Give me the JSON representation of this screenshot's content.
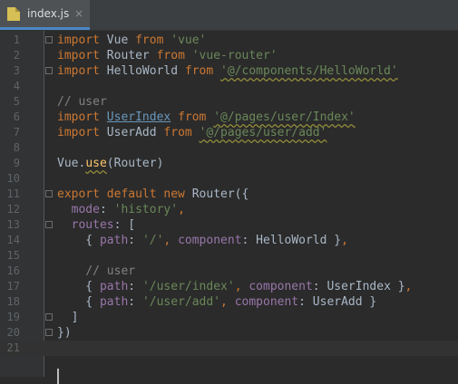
{
  "tab": {
    "filename": "index.js",
    "close_symbol": "×"
  },
  "colors": {
    "keyword": "#cc7832",
    "string": "#6a8759",
    "comment": "#808080",
    "property": "#9876aa",
    "default": "#a9b7c6",
    "background": "#2b2b2b"
  },
  "lines": [
    {
      "n": "1",
      "tokens": [
        [
          "kw",
          "import"
        ],
        [
          "p",
          " Vue "
        ],
        [
          "kw",
          "from"
        ],
        [
          "p",
          " "
        ],
        [
          "str",
          "'vue'"
        ]
      ]
    },
    {
      "n": "2",
      "tokens": [
        [
          "kw",
          "import"
        ],
        [
          "p",
          " Router "
        ],
        [
          "kw",
          "from"
        ],
        [
          "p",
          " "
        ],
        [
          "str",
          "'vue-router'"
        ]
      ]
    },
    {
      "n": "3",
      "tokens": [
        [
          "kw",
          "import"
        ],
        [
          "p",
          " HelloWorld "
        ],
        [
          "kw",
          "from"
        ],
        [
          "p",
          " "
        ],
        [
          "stru",
          "'@/components/HelloWorld'"
        ]
      ]
    },
    {
      "n": "4",
      "tokens": []
    },
    {
      "n": "5",
      "tokens": [
        [
          "cmt",
          "// user"
        ]
      ]
    },
    {
      "n": "6",
      "tokens": [
        [
          "kw",
          "import"
        ],
        [
          "p",
          " "
        ],
        [
          "link",
          "UserIndex"
        ],
        [
          "p",
          " "
        ],
        [
          "kw",
          "from"
        ],
        [
          "p",
          " "
        ],
        [
          "stru",
          "'@/pages/user/Index'"
        ]
      ]
    },
    {
      "n": "7",
      "tokens": [
        [
          "kw",
          "import"
        ],
        [
          "p",
          " UserAdd "
        ],
        [
          "kw",
          "from"
        ],
        [
          "p",
          " "
        ],
        [
          "stru",
          "'@/pages/user/add'"
        ]
      ]
    },
    {
      "n": "8",
      "tokens": []
    },
    {
      "n": "9",
      "tokens": [
        [
          "p",
          "Vue."
        ],
        [
          "fnu",
          "use"
        ],
        [
          "p",
          "(Router)"
        ]
      ]
    },
    {
      "n": "10",
      "tokens": []
    },
    {
      "n": "11",
      "tokens": [
        [
          "kw",
          "export default new"
        ],
        [
          "p",
          " Router({"
        ]
      ]
    },
    {
      "n": "12",
      "tokens": [
        [
          "p",
          "  "
        ],
        [
          "prop",
          "mode"
        ],
        [
          "p",
          ": "
        ],
        [
          "str",
          "'history'"
        ],
        [
          "kw",
          ","
        ]
      ]
    },
    {
      "n": "13",
      "tokens": [
        [
          "p",
          "  "
        ],
        [
          "prop",
          "routes"
        ],
        [
          "p",
          ": ["
        ]
      ]
    },
    {
      "n": "14",
      "tokens": [
        [
          "p",
          "    { "
        ],
        [
          "prop",
          "path"
        ],
        [
          "p",
          ": "
        ],
        [
          "str",
          "'/'"
        ],
        [
          "kw",
          ","
        ],
        [
          "p",
          " "
        ],
        [
          "prop",
          "component"
        ],
        [
          "p",
          ": HelloWorld }"
        ],
        [
          "kw",
          ","
        ]
      ]
    },
    {
      "n": "15",
      "tokens": []
    },
    {
      "n": "16",
      "tokens": [
        [
          "p",
          "    "
        ],
        [
          "cmt",
          "// user"
        ]
      ]
    },
    {
      "n": "17",
      "tokens": [
        [
          "p",
          "    { "
        ],
        [
          "prop",
          "path"
        ],
        [
          "p",
          ": "
        ],
        [
          "str",
          "'/user/index'"
        ],
        [
          "kw",
          ","
        ],
        [
          "p",
          " "
        ],
        [
          "prop",
          "component"
        ],
        [
          "p",
          ": UserIndex }"
        ],
        [
          "kw",
          ","
        ]
      ]
    },
    {
      "n": "18",
      "tokens": [
        [
          "p",
          "    { "
        ],
        [
          "prop",
          "path"
        ],
        [
          "p",
          ": "
        ],
        [
          "str",
          "'/user/add'"
        ],
        [
          "kw",
          ","
        ],
        [
          "p",
          " "
        ],
        [
          "prop",
          "component"
        ],
        [
          "p",
          ": UserAdd }"
        ]
      ]
    },
    {
      "n": "19",
      "tokens": [
        [
          "p",
          "  ]"
        ]
      ]
    },
    {
      "n": "20",
      "tokens": [
        [
          "p",
          "})"
        ]
      ]
    },
    {
      "n": "21",
      "tokens": []
    }
  ]
}
